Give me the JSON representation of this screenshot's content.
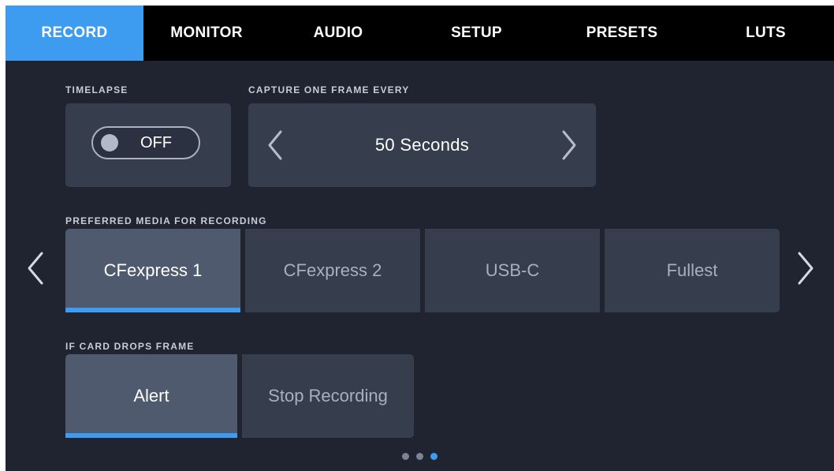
{
  "tabs": [
    {
      "label": "RECORD",
      "active": true
    },
    {
      "label": "MONITOR",
      "active": false
    },
    {
      "label": "AUDIO",
      "active": false
    },
    {
      "label": "SETUP",
      "active": false
    },
    {
      "label": "PRESETS",
      "active": false
    },
    {
      "label": "LUTS",
      "active": false
    }
  ],
  "timelapse": {
    "label": "TIMELAPSE",
    "toggle_value": "OFF"
  },
  "capture": {
    "label": "CAPTURE ONE FRAME EVERY",
    "value": "50 Seconds"
  },
  "preferred_media": {
    "label": "PREFERRED MEDIA FOR RECORDING",
    "options": [
      "CFexpress 1",
      "CFexpress 2",
      "USB-C",
      "Fullest"
    ],
    "selected": "CFexpress 1"
  },
  "card_drops": {
    "label": "IF CARD DROPS FRAME",
    "options": [
      "Alert",
      "Stop Recording"
    ],
    "selected": "Alert"
  },
  "pagination": {
    "total": 3,
    "current": 3
  },
  "colors": {
    "accent": "#3d9bf0",
    "background": "#1f2430",
    "panel": "#363d4c",
    "selected_panel": "#505a6f",
    "tabbar": "#000000"
  },
  "icons": {
    "stepper_prev": "chevron-left-icon",
    "stepper_next": "chevron-right-icon",
    "page_prev": "chevron-left-icon",
    "page_next": "chevron-right-icon"
  }
}
